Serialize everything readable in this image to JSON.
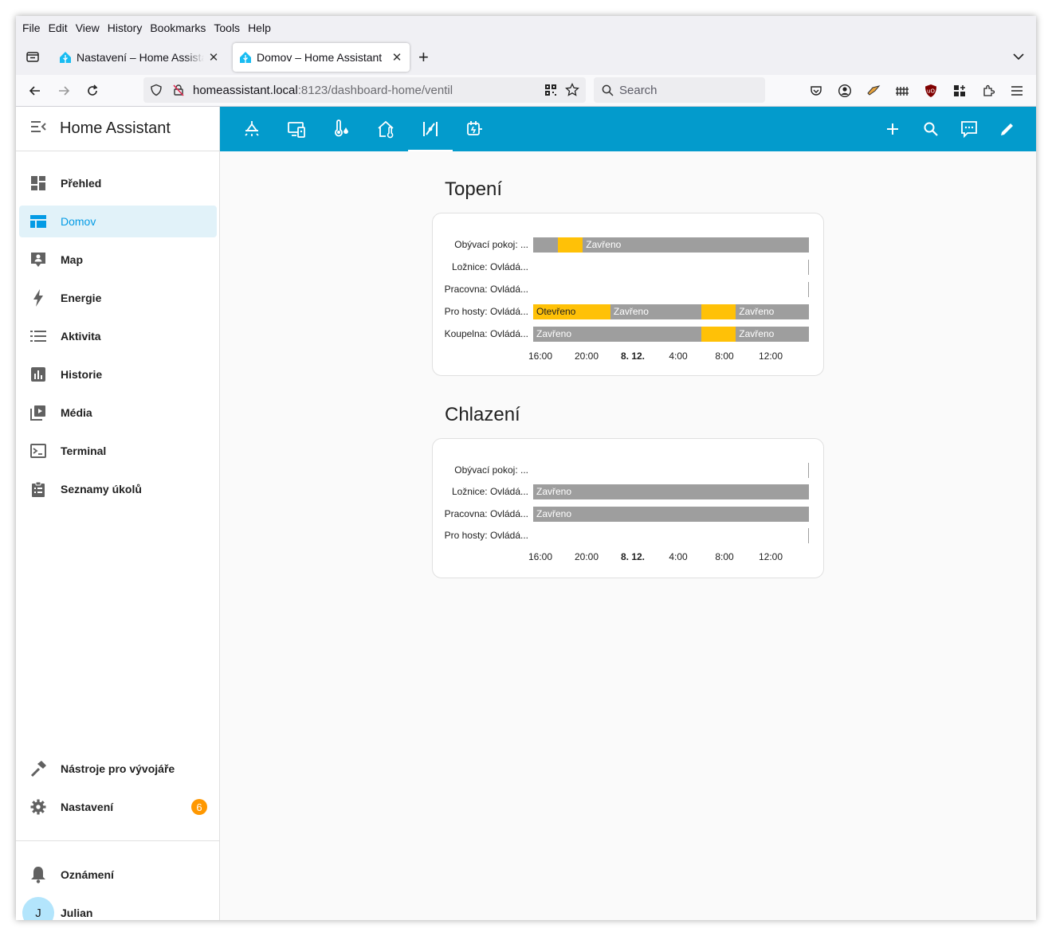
{
  "browser": {
    "menu": [
      "File",
      "Edit",
      "View",
      "History",
      "Bookmarks",
      "Tools",
      "Help"
    ],
    "tabs": [
      {
        "title": "Nastavení – Home Assistant",
        "active": false
      },
      {
        "title": "Domov – Home Assistant",
        "active": true
      }
    ],
    "url_host": "homeassistant.local",
    "url_rest": ":8123/dashboard-home/ventil",
    "search_placeholder": "Search"
  },
  "sidebar": {
    "title": "Home Assistant",
    "items": [
      {
        "label": "Přehled",
        "icon": "dashboard-icon"
      },
      {
        "label": "Domov",
        "icon": "view-dashboard-icon",
        "selected": true
      },
      {
        "label": "Map",
        "icon": "map-account-icon"
      },
      {
        "label": "Energie",
        "icon": "lightning-icon"
      },
      {
        "label": "Aktivita",
        "icon": "list-icon"
      },
      {
        "label": "Historie",
        "icon": "chart-box-icon"
      },
      {
        "label": "Média",
        "icon": "media-play-icon"
      },
      {
        "label": "Terminal",
        "icon": "console-icon"
      },
      {
        "label": "Seznamy úkolů",
        "icon": "clipboard-list-icon"
      }
    ],
    "dev_tools": "Nástroje pro vývojáře",
    "settings": "Nastavení",
    "settings_badge": "6",
    "notifications": "Oznámení",
    "user": "Julian",
    "user_initial": "J"
  },
  "toolbar": {
    "views": [
      "ceiling-light-icon",
      "remote-tv-icon",
      "thermometer-water-icon",
      "home-thermometer-icon",
      "valve-icon",
      "power-plug-icon"
    ],
    "active_view": 4,
    "actions": [
      "plus-icon",
      "search-icon",
      "assist-icon",
      "pencil-icon"
    ]
  },
  "colors": {
    "toolbar": "#039bcc",
    "open": "#ffc107",
    "closed": "#9e9e9e",
    "accent": "#039be5"
  },
  "cards": [
    {
      "title": "Topení",
      "ticks": [
        "16:00",
        "20:00",
        "8. 12.",
        "4:00",
        "8:00",
        "12:00"
      ],
      "rows": [
        {
          "label": "Obývací pokoj: ...",
          "segments": [
            {
              "state": "closed",
              "start": 0,
              "end": 0.09,
              "text": ""
            },
            {
              "state": "open",
              "start": 0.09,
              "end": 0.18,
              "text": ""
            },
            {
              "state": "closed",
              "start": 0.18,
              "end": 1,
              "text": "Zavřeno"
            }
          ]
        },
        {
          "label": "Ložnice: Ovládá...",
          "segments": []
        },
        {
          "label": "Pracovna: Ovládá...",
          "segments": []
        },
        {
          "label": "Pro hosty: Ovládá...",
          "segments": [
            {
              "state": "open",
              "start": 0,
              "end": 0.28,
              "text": "Otevřeno"
            },
            {
              "state": "closed",
              "start": 0.28,
              "end": 0.61,
              "text": "Zavřeno"
            },
            {
              "state": "open",
              "start": 0.61,
              "end": 0.735,
              "text": ""
            },
            {
              "state": "closed",
              "start": 0.735,
              "end": 1,
              "text": "Zavřeno"
            }
          ]
        },
        {
          "label": "Koupelna: Ovládá...",
          "segments": [
            {
              "state": "closed",
              "start": 0,
              "end": 0.61,
              "text": "Zavřeno"
            },
            {
              "state": "open",
              "start": 0.61,
              "end": 0.735,
              "text": ""
            },
            {
              "state": "closed",
              "start": 0.735,
              "end": 1,
              "text": "Zavřeno"
            }
          ]
        }
      ]
    },
    {
      "title": "Chlazení",
      "ticks": [
        "16:00",
        "20:00",
        "8. 12.",
        "4:00",
        "8:00",
        "12:00"
      ],
      "rows": [
        {
          "label": "Obývací pokoj: ...",
          "segments": []
        },
        {
          "label": "Ložnice: Ovládá...",
          "segments": [
            {
              "state": "closed",
              "start": 0,
              "end": 1,
              "text": "Zavřeno"
            }
          ]
        },
        {
          "label": "Pracovna: Ovládá...",
          "segments": [
            {
              "state": "closed",
              "start": 0,
              "end": 1,
              "text": "Zavřeno"
            }
          ]
        },
        {
          "label": "Pro hosty: Ovládá...",
          "segments": []
        }
      ]
    }
  ]
}
